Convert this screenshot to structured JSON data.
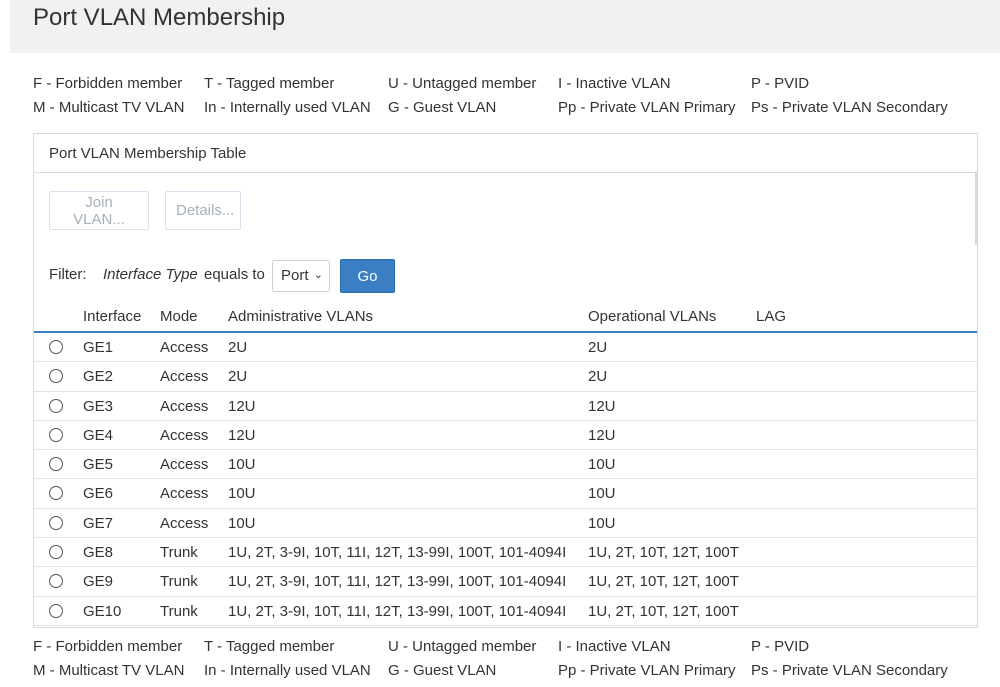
{
  "page": {
    "title": "Port VLAN Membership"
  },
  "legend": [
    [
      "F - Forbidden member",
      "T - Tagged member",
      "U - Untagged member",
      "I - Inactive VLAN",
      "P - PVID"
    ],
    [
      "M - Multicast TV VLAN",
      "In - Internally used VLAN",
      "G - Guest VLAN",
      "Pp - Private VLAN Primary",
      "Ps - Private VLAN Secondary"
    ]
  ],
  "panel": {
    "title": "Port VLAN Membership Table",
    "join_label": "Join VLAN...",
    "details_label": "Details..."
  },
  "filter": {
    "label": "Filter:",
    "field": "Interface Type",
    "operator": "equals to",
    "value": "Port",
    "go_label": "Go"
  },
  "table": {
    "headers": [
      "Interface",
      "Mode",
      "Administrative VLANs",
      "Operational VLANs",
      "LAG"
    ],
    "rows": [
      [
        "GE1",
        "Access",
        "2U",
        "2U",
        ""
      ],
      [
        "GE2",
        "Access",
        "2U",
        "2U",
        ""
      ],
      [
        "GE3",
        "Access",
        "12U",
        "12U",
        ""
      ],
      [
        "GE4",
        "Access",
        "12U",
        "12U",
        ""
      ],
      [
        "GE5",
        "Access",
        "10U",
        "10U",
        ""
      ],
      [
        "GE6",
        "Access",
        "10U",
        "10U",
        ""
      ],
      [
        "GE7",
        "Access",
        "10U",
        "10U",
        ""
      ],
      [
        "GE8",
        "Trunk",
        "1U, 2T, 3-9I, 10T, 11I, 12T, 13-99I, 100T, 101-4094I",
        "1U, 2T, 10T, 12T, 100T",
        ""
      ],
      [
        "GE9",
        "Trunk",
        "1U, 2T, 3-9I, 10T, 11I, 12T, 13-99I, 100T, 101-4094I",
        "1U, 2T, 10T, 12T, 100T",
        ""
      ],
      [
        "GE10",
        "Trunk",
        "1U, 2T, 3-9I, 10T, 11I, 12T, 13-99I, 100T, 101-4094I",
        "1U, 2T, 10T, 12T, 100T",
        ""
      ]
    ]
  },
  "colors": {
    "accent": "#3a7fc4",
    "header_bg": "#f1f1f1",
    "border": "#d9d9d9"
  }
}
